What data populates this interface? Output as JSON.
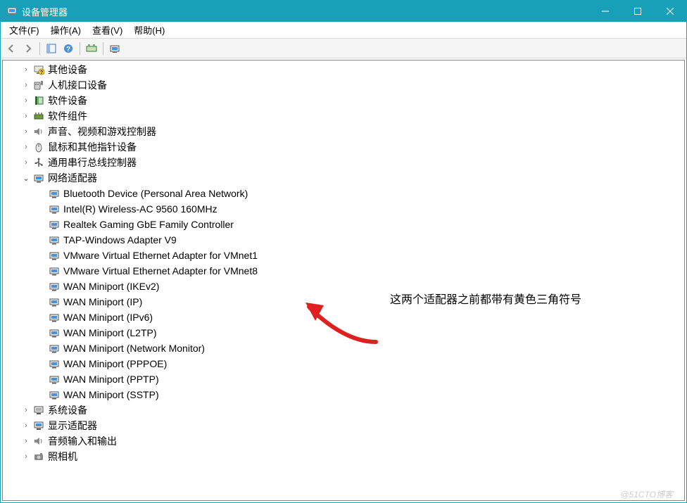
{
  "window": {
    "title": "设备管理器"
  },
  "menu": {
    "file": "文件(F)",
    "action": "操作(A)",
    "view": "查看(V)",
    "help": "帮助(H)"
  },
  "categories": [
    {
      "id": "other",
      "label": "其他设备",
      "icon": "warn",
      "expanded": false
    },
    {
      "id": "hid",
      "label": "人机接口设备",
      "icon": "hid",
      "expanded": false
    },
    {
      "id": "software",
      "label": "软件设备",
      "icon": "soft",
      "expanded": false
    },
    {
      "id": "swcomp",
      "label": "软件组件",
      "icon": "swcomp",
      "expanded": false
    },
    {
      "id": "sound",
      "label": "声音、视频和游戏控制器",
      "icon": "speaker",
      "expanded": false
    },
    {
      "id": "mouse",
      "label": "鼠标和其他指针设备",
      "icon": "mouse",
      "expanded": false
    },
    {
      "id": "usb",
      "label": "通用串行总线控制器",
      "icon": "usb",
      "expanded": false
    },
    {
      "id": "net",
      "label": "网络适配器",
      "icon": "net",
      "expanded": true,
      "children": [
        "Bluetooth Device (Personal Area Network)",
        "Intel(R) Wireless-AC 9560 160MHz",
        "Realtek Gaming GbE Family Controller",
        "TAP-Windows Adapter V9",
        "VMware Virtual Ethernet Adapter for VMnet1",
        "VMware Virtual Ethernet Adapter for VMnet8",
        "WAN Miniport (IKEv2)",
        "WAN Miniport (IP)",
        "WAN Miniport (IPv6)",
        "WAN Miniport (L2TP)",
        "WAN Miniport (Network Monitor)",
        "WAN Miniport (PPPOE)",
        "WAN Miniport (PPTP)",
        "WAN Miniport (SSTP)"
      ]
    },
    {
      "id": "system",
      "label": "系统设备",
      "icon": "system",
      "expanded": false
    },
    {
      "id": "display",
      "label": "显示适配器",
      "icon": "display",
      "expanded": false
    },
    {
      "id": "audio",
      "label": "音频输入和输出",
      "icon": "speaker",
      "expanded": false
    },
    {
      "id": "camera",
      "label": "照相机",
      "icon": "camera",
      "expanded": false
    }
  ],
  "annotation": "这两个适配器之前都带有黄色三角符号",
  "watermark": "@51CTO博客"
}
